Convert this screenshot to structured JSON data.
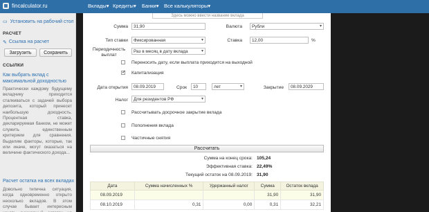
{
  "topbar": {
    "brand": "fincalculator.ru",
    "nav": [
      {
        "label": "Вклады",
        "caret": "▾"
      },
      {
        "label": "Кредиты",
        "caret": "▾"
      },
      {
        "label": "Банки",
        "caret": "▾"
      },
      {
        "label": "Все калькуляторы",
        "caret": "▾"
      }
    ],
    "color": "#2f6fa8"
  },
  "sidebar": {
    "install_label": "Установить на рабочий стол",
    "section_calc": "РАСЧЕТ",
    "link_calc": "Ссылка на расчет",
    "load_button": "Загрузить",
    "save_button": "Сохранить",
    "section_links": "ССЫЛКИ",
    "article1_title": "Как выбрать вклад с максимальной доходностью",
    "article1_text": "Практически каждому будущему вкладчику приходится сталкиваться с задачей выбора депозита, который принесет наибольшую доходность. Процентная ставка, декларируемая банком, не может служить единственным критерием для сравнения. Выделим факторы, которые, так или иначе, могут оказаться на величине фактического дохода...",
    "article2_title": "Расчет остатка на всех вкладах",
    "article2_text": "Довольно типична ситуация, когда одновременно открыто несколько вкладов. В этом случае бывает интересным узнать суммарный остаток на сегодняшний день, в последующие месяцы и в конце"
  },
  "form": {
    "deposit_name_placeholder": "Здесь можно ввести название вклада",
    "sum_label": "Сумма",
    "sum_value": "31,90",
    "currency_label": "Валюта",
    "currency_value": "Рубли",
    "rate_type_label": "Тип ставки",
    "rate_type_value": "Фиксированная",
    "rate_label": "Ставка",
    "rate_value": "12,00",
    "rate_unit": "%",
    "period_label": "Периодичность выплат",
    "period_value": "Раз в месяц в дату вклада",
    "transfer_label": "Переносить дату, если выплата приходится на выходной",
    "transfer_checked": false,
    "capitalization_label": "Капитализация",
    "capitalization_checked": true,
    "open_date_label": "Дата открытия",
    "open_date_value": "08.09.2019",
    "term_label": "Срок",
    "term_value": "10",
    "term_unit_value": "лет",
    "close_label": "Закрытие",
    "close_value": "08.09.2029",
    "tax_label": "Налог",
    "tax_value": "Для резидентов РФ",
    "early_label": "Рассчитывать досрочное закрытие вклада",
    "early_checked": false,
    "replenish_label": "Пополнения вклада",
    "replenish_checked": false,
    "partial_label": "Частичные снятия",
    "partial_checked": false,
    "calc_button": "Рассчитать"
  },
  "results": {
    "end_sum_label": "Сумма на конец срока:",
    "end_sum_value": "105,24",
    "eff_rate_label": "Эффективная ставка:",
    "eff_rate_value": "22,49%",
    "current_label": "Текущий остаток на 08.09.2019:",
    "current_value": "31,90"
  },
  "table": {
    "headers": [
      "Дата",
      "Сумма начисленных %",
      "Удержанный налог",
      "Сумма",
      "Остаток вклада"
    ],
    "rows": [
      {
        "date": "08.09.2019",
        "interest": "",
        "tax": "",
        "sum": "31,90",
        "balance": "31,90"
      },
      {
        "date": "08.10.2019",
        "interest": "0,31",
        "tax": "0,00",
        "sum": "0,31",
        "balance": "32,21"
      }
    ]
  }
}
